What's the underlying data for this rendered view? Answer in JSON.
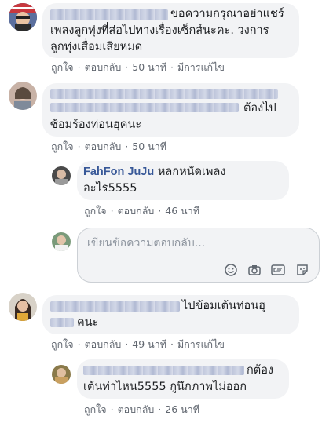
{
  "comments": [
    {
      "text_lines": [
        "ขอความกรุณาอย่าแชร์",
        "เพลงลูกทุ่งที่ส่อไปทางเรื่องเซ็กส์นะคะ. วงการ",
        "ลูกทุ่งเสื่อมเสียหมด"
      ],
      "actions": {
        "like": "ถูกใจ",
        "reply": "ตอบกลับ",
        "time": "50 นาที",
        "edited": "มีการแก้ไข"
      }
    },
    {
      "text_lines": [
        "ต้องไป",
        "ซ้อมร้องท่อนฮุคนะ"
      ],
      "actions": {
        "like": "ถูกใจ",
        "reply": "ตอบกลับ",
        "time": "50 นาที"
      },
      "reply": {
        "author": "FahFon JuJu",
        "text_lines": [
          "หลกหนัดเพลง",
          "อะไร5555"
        ],
        "actions": {
          "like": "ถูกใจ",
          "reply": "ตอบกลับ",
          "time": "46 นาที"
        }
      }
    },
    {
      "text_lines": [
        "ไปข้อมเต้นท่อนฮุ",
        "คนะ"
      ],
      "actions": {
        "like": "ถูกใจ",
        "reply": "ตอบกลับ",
        "time": "49 นาที",
        "edited": "มีการแก้ไข"
      },
      "reply": {
        "text_lines": [
          "กต้อง",
          "เต้นท่าไหน5555 กูนึกภาพไม่ออก"
        ],
        "actions": {
          "like": "ถูกใจ",
          "reply": "ตอบกลับ",
          "time": "26 นาที"
        }
      }
    }
  ],
  "reply_box": {
    "placeholder": "เขียนข้อความตอบกลับ...",
    "icons": [
      "smiley-icon",
      "camera-icon",
      "gif-icon",
      "sticker-icon"
    ]
  },
  "separator": "·"
}
